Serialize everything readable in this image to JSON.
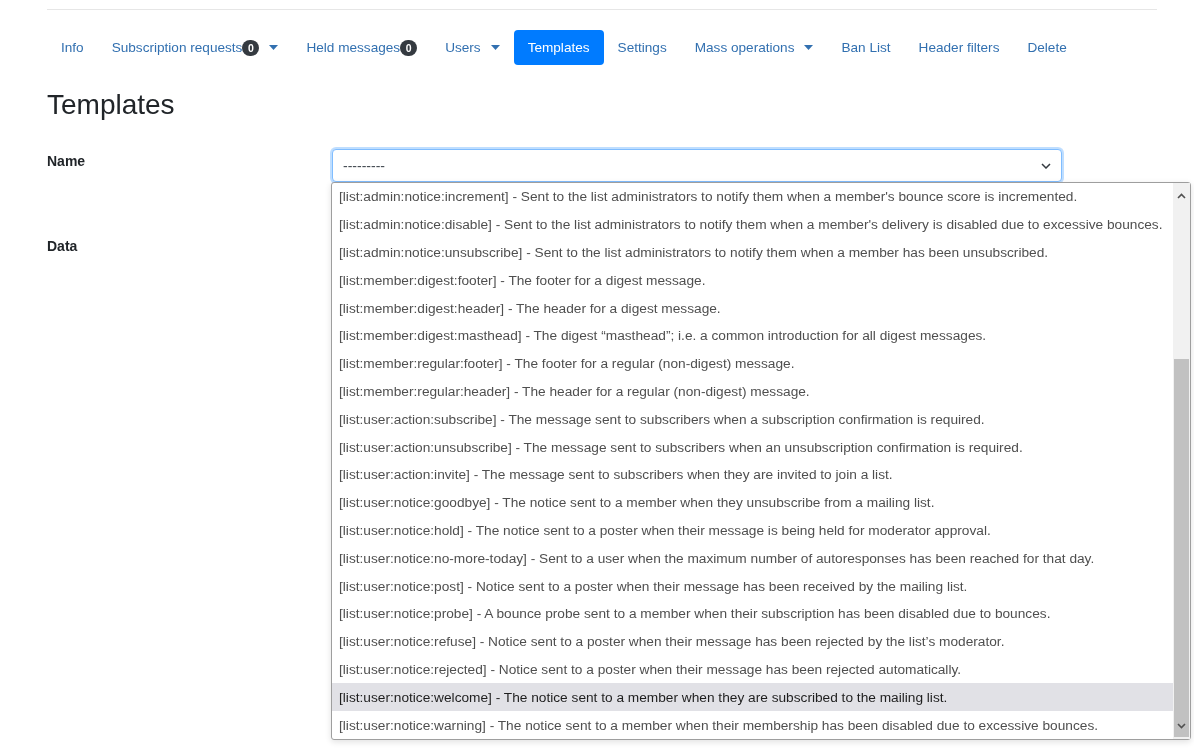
{
  "tabs": [
    {
      "label": "Info",
      "has_menu": false,
      "selected": false
    },
    {
      "label": "Subscription requests",
      "badge": "0",
      "has_menu": true,
      "selected": false
    },
    {
      "label": "Held messages",
      "badge": "0",
      "has_menu": false,
      "selected": false
    },
    {
      "label": "Users",
      "has_menu": true,
      "selected": false
    },
    {
      "label": "Templates",
      "has_menu": false,
      "selected": true
    },
    {
      "label": "Settings",
      "has_menu": false,
      "selected": false
    },
    {
      "label": "Mass operations",
      "has_menu": true,
      "selected": false
    },
    {
      "label": "Ban List",
      "has_menu": false,
      "selected": false
    },
    {
      "label": "Header filters",
      "has_menu": false,
      "selected": false
    },
    {
      "label": "Delete",
      "has_menu": false,
      "selected": false
    }
  ],
  "heading": "Templates",
  "form": {
    "name_field": {
      "label": "Name",
      "value": "---------",
      "expanded": true,
      "options": [
        {
          "text": "[list:admin:notice:increment] - Sent to the list administrators to notify them when a member's bounce score is incremented.",
          "selected": false
        },
        {
          "text": "[list:admin:notice:disable] - Sent to the list administrators to notify them when a member's delivery is disabled due to excessive bounces.",
          "selected": false
        },
        {
          "text": "[list:admin:notice:unsubscribe] - Sent to the list administrators to notify them when a member has been unsubscribed.",
          "selected": false
        },
        {
          "text": "[list:member:digest:footer] - The footer for a digest message.",
          "selected": false
        },
        {
          "text": "[list:member:digest:header] - The header for a digest message.",
          "selected": false
        },
        {
          "text": "[list:member:digest:masthead] - The digest “masthead”; i.e. a common introduction for all digest messages.",
          "selected": false
        },
        {
          "text": "[list:member:regular:footer] - The footer for a regular (non-digest) message.",
          "selected": false
        },
        {
          "text": "[list:member:regular:header] - The header for a regular (non-digest) message.",
          "selected": false
        },
        {
          "text": "[list:user:action:subscribe] - The message sent to subscribers when a subscription confirmation is required.",
          "selected": false
        },
        {
          "text": "[list:user:action:unsubscribe] - The message sent to subscribers when an unsubscription confirmation is required.",
          "selected": false
        },
        {
          "text": "[list:user:action:invite] - The message sent to subscribers when they are invited to join a list.",
          "selected": false
        },
        {
          "text": "[list:user:notice:goodbye] - The notice sent to a member when they unsubscribe from a mailing list.",
          "selected": false
        },
        {
          "text": "[list:user:notice:hold] - The notice sent to a poster when their message is being held for moderator approval.",
          "selected": false
        },
        {
          "text": "[list:user:notice:no-more-today] - Sent to a user when the maximum number of autoresponses has been reached for that day.",
          "selected": false
        },
        {
          "text": "[list:user:notice:post] - Notice sent to a poster when their message has been received by the mailing list.",
          "selected": false
        },
        {
          "text": "[list:user:notice:probe] - A bounce probe sent to a member when their subscription has been disabled due to bounces.",
          "selected": false
        },
        {
          "text": "[list:user:notice:refuse] - Notice sent to a poster when their message has been rejected by the list’s moderator.",
          "selected": false
        },
        {
          "text": "[list:user:notice:rejected] - Notice sent to a poster when their message has been rejected automatically.",
          "selected": false
        },
        {
          "text": "[list:user:notice:welcome] - The notice sent to a member when they are subscribed to the mailing list.",
          "selected": true
        },
        {
          "text": "[list:user:notice:warning] - The notice sent to a member when their membership has been disabled due to excessive bounces.",
          "selected": false
        }
      ]
    },
    "data_field": {
      "label": "Data"
    }
  }
}
